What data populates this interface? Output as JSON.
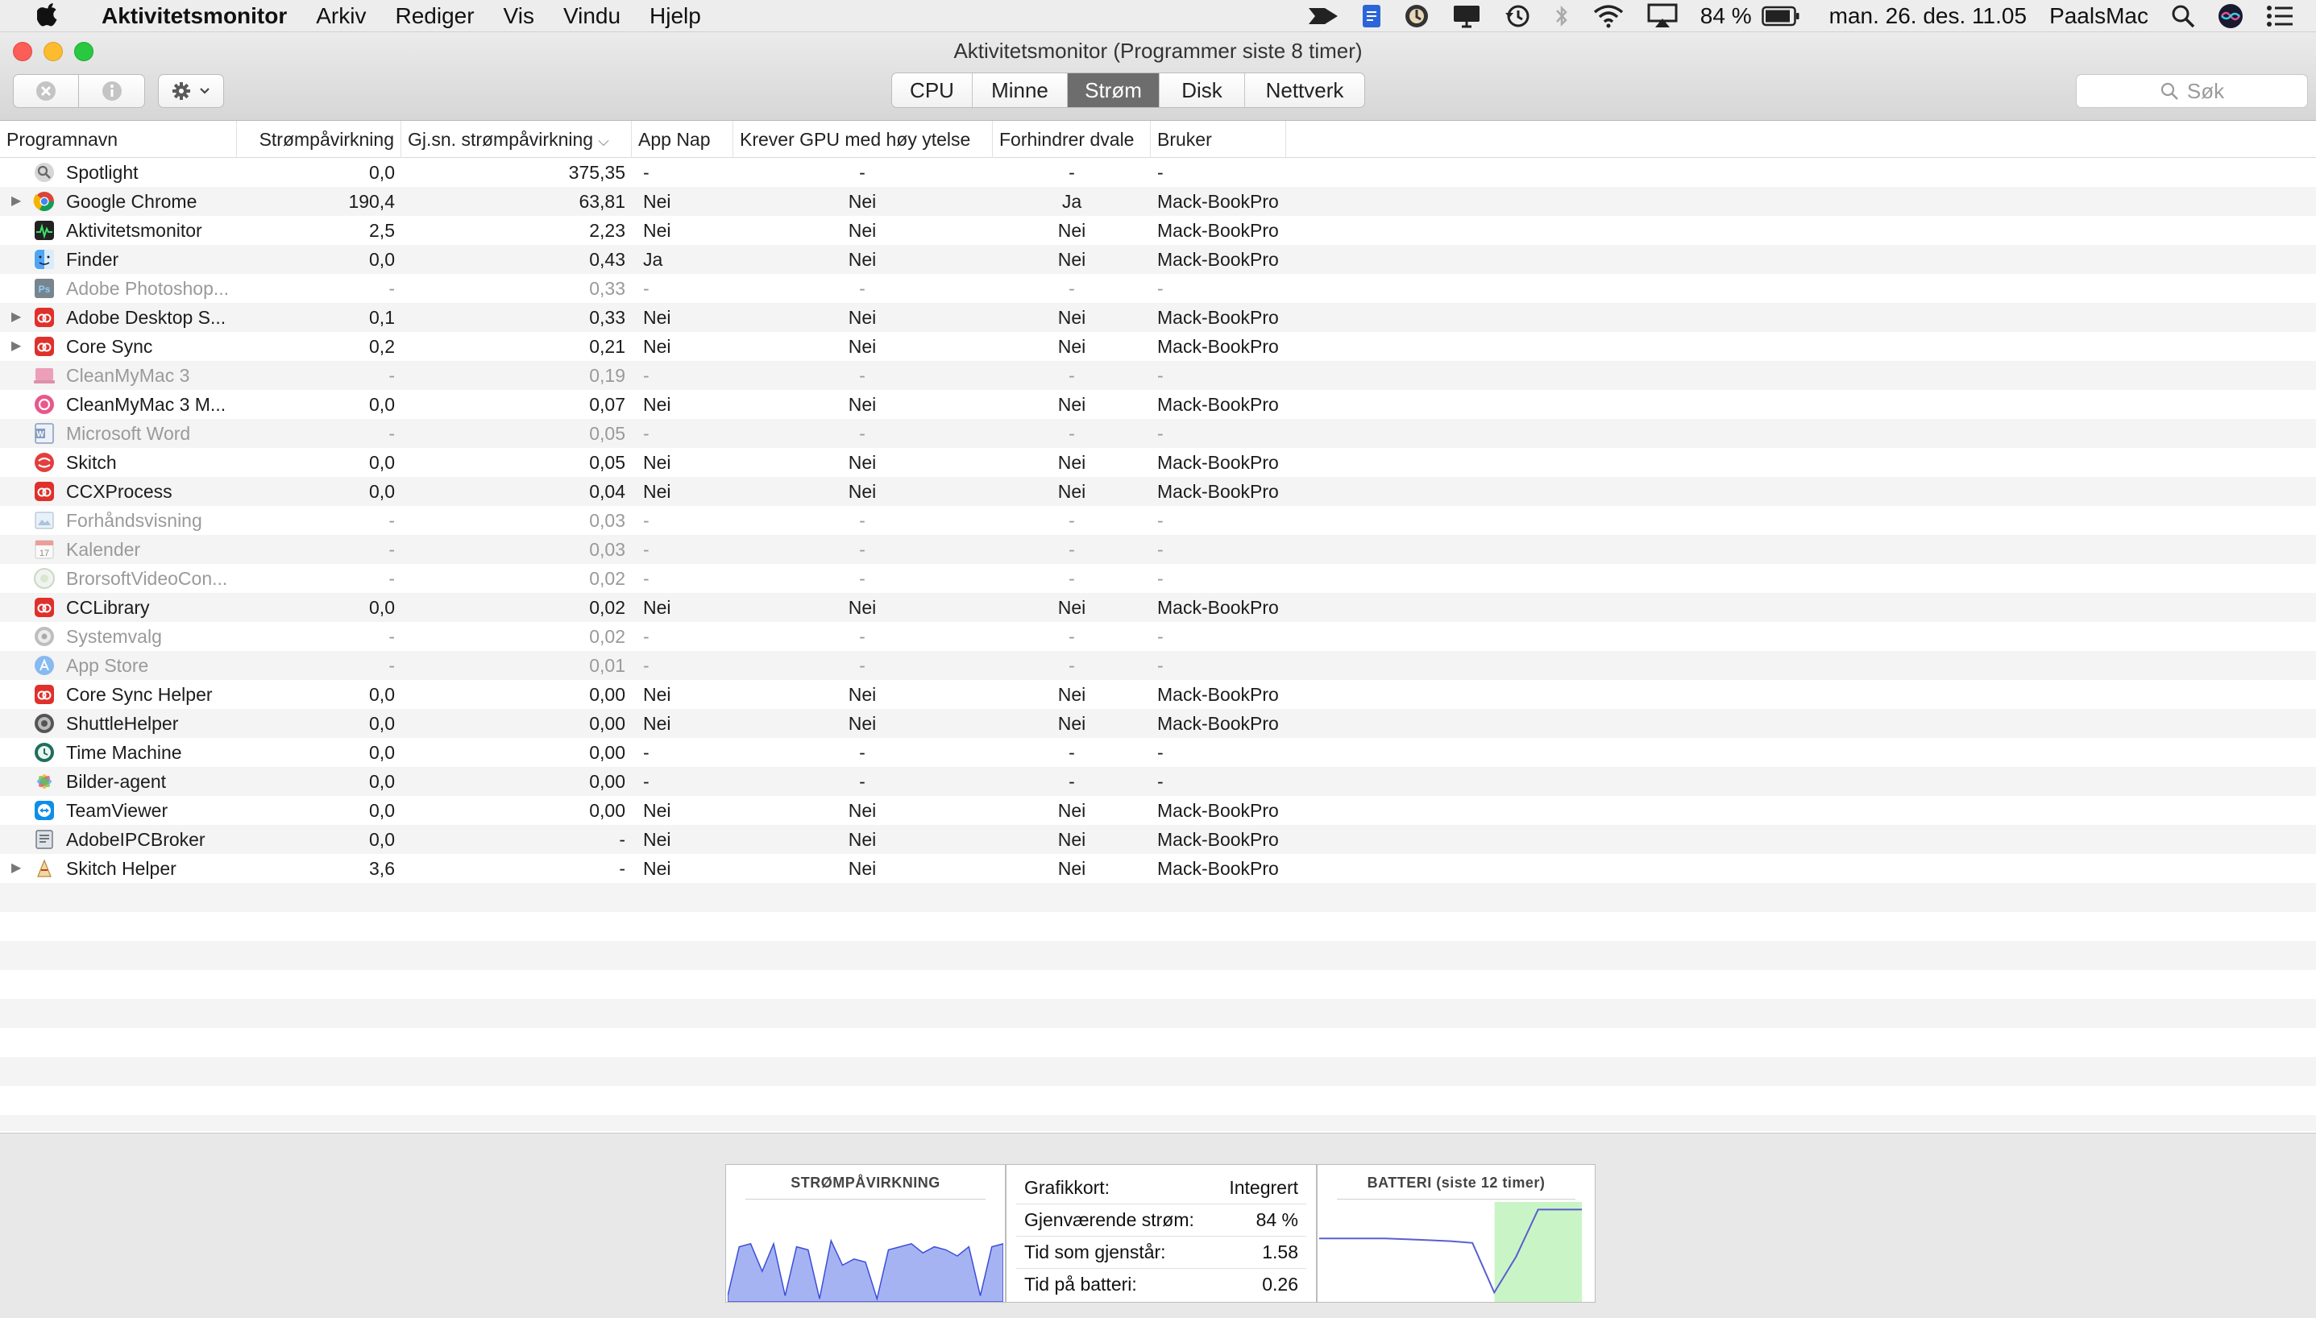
{
  "menubar": {
    "app_name": "Aktivitetsmonitor",
    "items": [
      "Arkiv",
      "Rediger",
      "Vis",
      "Vindu",
      "Hjelp"
    ],
    "battery_percent": "84 %",
    "datetime": "man. 26. des. 11.05",
    "computer_name": "PaalsMac"
  },
  "window": {
    "title": "Aktivitetsmonitor (Programmer siste 8 timer)",
    "tabs": [
      {
        "label": "CPU",
        "active": false
      },
      {
        "label": "Minne",
        "active": false
      },
      {
        "label": "Strøm",
        "active": true
      },
      {
        "label": "Disk",
        "active": false
      },
      {
        "label": "Nettverk",
        "active": false
      }
    ],
    "search_placeholder": "Søk"
  },
  "table": {
    "columns": [
      "Programnavn",
      "Strømpåvirkning",
      "Gj.sn. strømpåvirkning",
      "App Nap",
      "Krever GPU med høy ytelse",
      "Forhindrer dvale",
      "Bruker"
    ],
    "rows": [
      {
        "name": "Spotlight",
        "icon": "spotlight-icon",
        "expandable": false,
        "dim": false,
        "energy": "0,0",
        "avg": "375,35",
        "nap": "-",
        "gpu": "-",
        "sleep": "-",
        "user": "-"
      },
      {
        "name": "Google Chrome",
        "icon": "chrome-icon",
        "expandable": true,
        "dim": false,
        "energy": "190,4",
        "avg": "63,81",
        "nap": "Nei",
        "gpu": "Nei",
        "sleep": "Ja",
        "user": "Mack-BookPro"
      },
      {
        "name": "Aktivitetsmonitor",
        "icon": "activity-monitor-icon",
        "expandable": false,
        "dim": false,
        "energy": "2,5",
        "avg": "2,23",
        "nap": "Nei",
        "gpu": "Nei",
        "sleep": "Nei",
        "user": "Mack-BookPro"
      },
      {
        "name": "Finder",
        "icon": "finder-icon",
        "expandable": false,
        "dim": false,
        "energy": "0,0",
        "avg": "0,43",
        "nap": "Ja",
        "gpu": "Nei",
        "sleep": "Nei",
        "user": "Mack-BookPro"
      },
      {
        "name": "Adobe Photoshop...",
        "icon": "photoshop-icon",
        "expandable": false,
        "dim": true,
        "energy": "-",
        "avg": "0,33",
        "nap": "-",
        "gpu": "-",
        "sleep": "-",
        "user": "-"
      },
      {
        "name": "Adobe Desktop S...",
        "icon": "creative-cloud-icon",
        "expandable": true,
        "dim": false,
        "energy": "0,1",
        "avg": "0,33",
        "nap": "Nei",
        "gpu": "Nei",
        "sleep": "Nei",
        "user": "Mack-BookPro"
      },
      {
        "name": "Core Sync",
        "icon": "creative-cloud-icon",
        "expandable": true,
        "dim": false,
        "energy": "0,2",
        "avg": "0,21",
        "nap": "Nei",
        "gpu": "Nei",
        "sleep": "Nei",
        "user": "Mack-BookPro"
      },
      {
        "name": "CleanMyMac 3",
        "icon": "cleanmymac-icon",
        "expandable": false,
        "dim": true,
        "energy": "-",
        "avg": "0,19",
        "nap": "-",
        "gpu": "-",
        "sleep": "-",
        "user": "-"
      },
      {
        "name": "CleanMyMac 3 M...",
        "icon": "cleanmymac-menu-icon",
        "expandable": false,
        "dim": false,
        "energy": "0,0",
        "avg": "0,07",
        "nap": "Nei",
        "gpu": "Nei",
        "sleep": "Nei",
        "user": "Mack-BookPro"
      },
      {
        "name": "Microsoft Word",
        "icon": "word-icon",
        "expandable": false,
        "dim": true,
        "energy": "-",
        "avg": "0,05",
        "nap": "-",
        "gpu": "-",
        "sleep": "-",
        "user": "-"
      },
      {
        "name": "Skitch",
        "icon": "skitch-icon",
        "expandable": false,
        "dim": false,
        "energy": "0,0",
        "avg": "0,05",
        "nap": "Nei",
        "gpu": "Nei",
        "sleep": "Nei",
        "user": "Mack-BookPro"
      },
      {
        "name": "CCXProcess",
        "icon": "creative-cloud-icon",
        "expandable": false,
        "dim": false,
        "energy": "0,0",
        "avg": "0,04",
        "nap": "Nei",
        "gpu": "Nei",
        "sleep": "Nei",
        "user": "Mack-BookPro"
      },
      {
        "name": "Forhåndsvisning",
        "icon": "preview-icon",
        "expandable": false,
        "dim": true,
        "energy": "-",
        "avg": "0,03",
        "nap": "-",
        "gpu": "-",
        "sleep": "-",
        "user": "-"
      },
      {
        "name": "Kalender",
        "icon": "calendar-icon",
        "expandable": false,
        "dim": true,
        "energy": "-",
        "avg": "0,03",
        "nap": "-",
        "gpu": "-",
        "sleep": "-",
        "user": "-"
      },
      {
        "name": "BrorsoftVideoCon...",
        "icon": "video-converter-icon",
        "expandable": false,
        "dim": true,
        "energy": "-",
        "avg": "0,02",
        "nap": "-",
        "gpu": "-",
        "sleep": "-",
        "user": "-"
      },
      {
        "name": "CCLibrary",
        "icon": "creative-cloud-icon",
        "expandable": false,
        "dim": false,
        "energy": "0,0",
        "avg": "0,02",
        "nap": "Nei",
        "gpu": "Nei",
        "sleep": "Nei",
        "user": "Mack-BookPro"
      },
      {
        "name": "Systemvalg",
        "icon": "system-preferences-icon",
        "expandable": false,
        "dim": true,
        "energy": "-",
        "avg": "0,02",
        "nap": "-",
        "gpu": "-",
        "sleep": "-",
        "user": "-"
      },
      {
        "name": "App Store",
        "icon": "app-store-icon",
        "expandable": false,
        "dim": true,
        "energy": "-",
        "avg": "0,01",
        "nap": "-",
        "gpu": "-",
        "sleep": "-",
        "user": "-"
      },
      {
        "name": "Core Sync Helper",
        "icon": "creative-cloud-icon",
        "expandable": false,
        "dim": false,
        "energy": "0,0",
        "avg": "0,00",
        "nap": "Nei",
        "gpu": "Nei",
        "sleep": "Nei",
        "user": "Mack-BookPro"
      },
      {
        "name": "ShuttleHelper",
        "icon": "shuttle-icon",
        "expandable": false,
        "dim": false,
        "energy": "0,0",
        "avg": "0,00",
        "nap": "Nei",
        "gpu": "Nei",
        "sleep": "Nei",
        "user": "Mack-BookPro"
      },
      {
        "name": "Time Machine",
        "icon": "time-machine-icon",
        "expandable": false,
        "dim": false,
        "energy": "0,0",
        "avg": "0,00",
        "nap": "-",
        "gpu": "-",
        "sleep": "-",
        "user": "-"
      },
      {
        "name": "Bilder-agent",
        "icon": "photos-icon",
        "expandable": false,
        "dim": false,
        "energy": "0,0",
        "avg": "0,00",
        "nap": "-",
        "gpu": "-",
        "sleep": "-",
        "user": "-"
      },
      {
        "name": "TeamViewer",
        "icon": "teamviewer-icon",
        "expandable": false,
        "dim": false,
        "energy": "0,0",
        "avg": "0,00",
        "nap": "Nei",
        "gpu": "Nei",
        "sleep": "Nei",
        "user": "Mack-BookPro"
      },
      {
        "name": "AdobeIPCBroker",
        "icon": "ipc-broker-icon",
        "expandable": false,
        "dim": false,
        "energy": "0,0",
        "avg": "-",
        "nap": "Nei",
        "gpu": "Nei",
        "sleep": "Nei",
        "user": "Mack-BookPro"
      },
      {
        "name": "Skitch Helper",
        "icon": "skitch-helper-icon",
        "expandable": true,
        "dim": false,
        "energy": "3,6",
        "avg": "-",
        "nap": "Nei",
        "gpu": "Nei",
        "sleep": "Nei",
        "user": "Mack-BookPro"
      }
    ]
  },
  "bottom": {
    "energy_graph_title": "STRØMPÅVIRKNING",
    "energy_graph_values": [
      0.1,
      0.9,
      0.95,
      0.5,
      0.95,
      0.1,
      0.9,
      0.85,
      0.05,
      1.0,
      0.6,
      0.7,
      0.65,
      0.05,
      0.85,
      0.9,
      0.95,
      0.8,
      0.9,
      0.85,
      0.75,
      0.9,
      0.1,
      0.9,
      0.95
    ],
    "graphics_label": "Grafikkort:",
    "graphics_value": "Integrert",
    "remaining_label": "Gjenværende strøm:",
    "remaining_value": "84 %",
    "time_left_label": "Tid som gjenstår:",
    "time_left_value": "1.58",
    "on_battery_label": "Tid på batteri:",
    "on_battery_value": "0.26",
    "battery_graph_title": "BATTERI (siste 12 timer)",
    "battery_graph_values": [
      0.65,
      0.65,
      0.65,
      0.65,
      0.64,
      0.63,
      0.62,
      0.6,
      0.05,
      0.45,
      0.97,
      0.97,
      0.97
    ],
    "battery_charging_from": 0.64,
    "colors": {
      "energy_fill": "#a6b3f3",
      "energy_stroke": "#3b4fd6",
      "charge_fill": "#c9f5c6",
      "battery_line": "#5a5ed0"
    }
  }
}
